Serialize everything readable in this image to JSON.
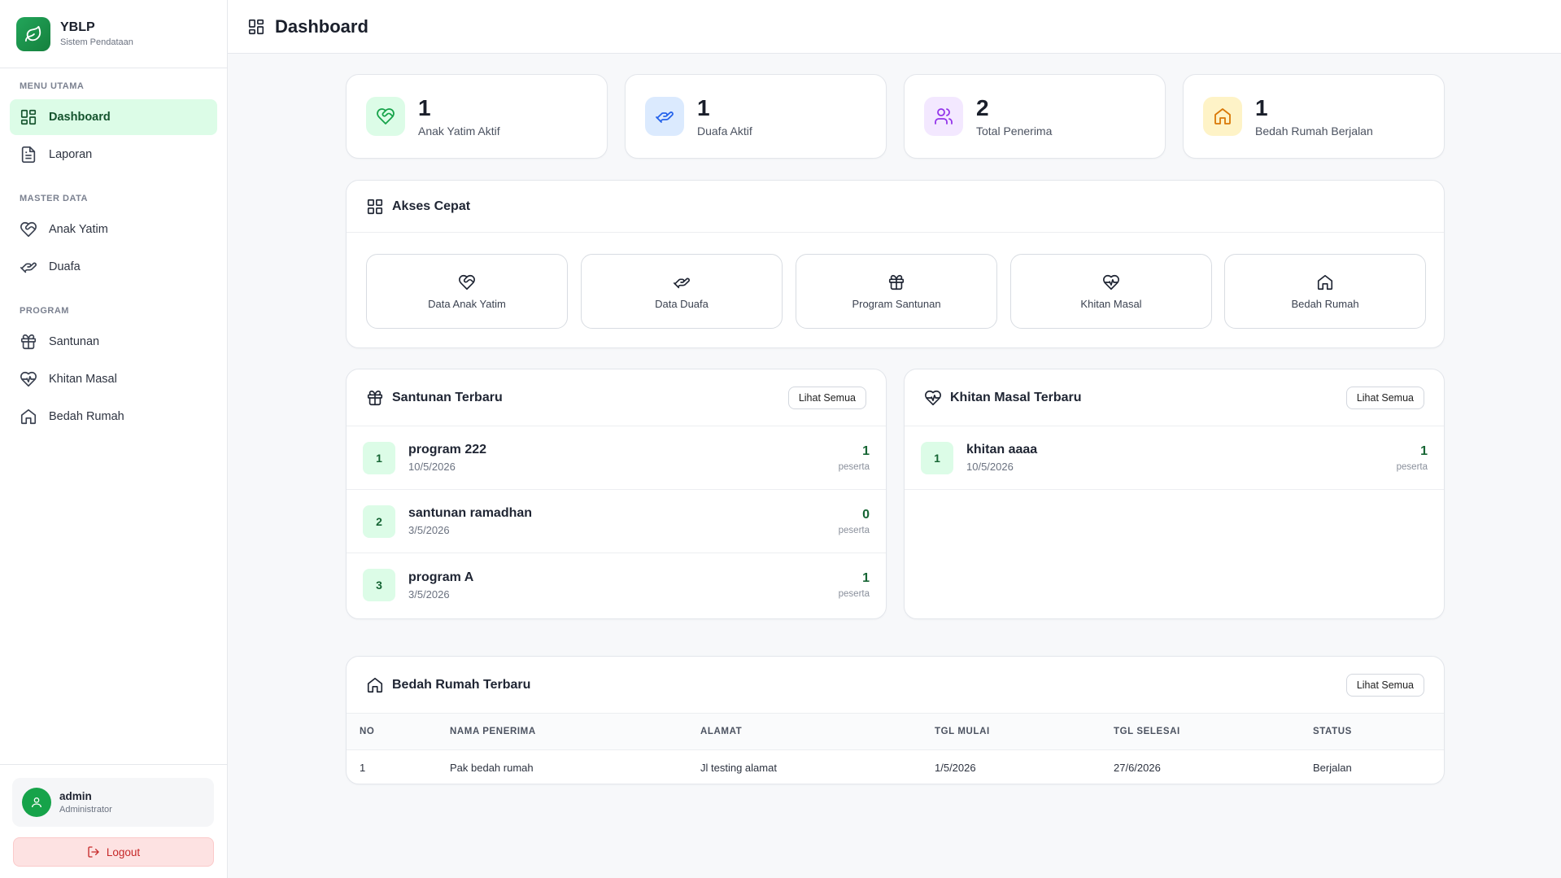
{
  "brand": {
    "title": "YBLP",
    "subtitle": "Sistem Pendataan"
  },
  "sidebar": {
    "sections": [
      {
        "heading": "MENU UTAMA",
        "items": [
          {
            "label": "Dashboard",
            "icon": "grid-icon",
            "active": true
          },
          {
            "label": "Laporan",
            "icon": "document-icon"
          }
        ]
      },
      {
        "heading": "MASTER DATA",
        "items": [
          {
            "label": "Anak Yatim",
            "icon": "heart-hand-icon"
          },
          {
            "label": "Duafa",
            "icon": "hand-coins-icon"
          }
        ]
      },
      {
        "heading": "PROGRAM",
        "items": [
          {
            "label": "Santunan",
            "icon": "gift-icon"
          },
          {
            "label": "Khitan Masal",
            "icon": "heart-pulse-icon"
          },
          {
            "label": "Bedah Rumah",
            "icon": "home-icon"
          }
        ]
      }
    ],
    "user": {
      "name": "admin",
      "role": "Administrator"
    },
    "logout_label": "Logout"
  },
  "header": {
    "title": "Dashboard"
  },
  "stats": [
    {
      "value": "1",
      "label": "Anak Yatim Aktif",
      "color": "#16a34a",
      "bg": "#dcfce7"
    },
    {
      "value": "1",
      "label": "Duafa Aktif",
      "color": "#2563eb",
      "bg": "#dbeafe"
    },
    {
      "value": "2",
      "label": "Total Penerima",
      "color": "#9333ea",
      "bg": "#f3e8ff"
    },
    {
      "value": "1",
      "label": "Bedah Rumah Berjalan",
      "color": "#d97706",
      "bg": "#fef3c7"
    }
  ],
  "quick_access": {
    "title": "Akses Cepat",
    "items": [
      {
        "label": "Data Anak Yatim",
        "icon": "heart-hand-icon"
      },
      {
        "label": "Data Duafa",
        "icon": "hand-coins-icon"
      },
      {
        "label": "Program Santunan",
        "icon": "gift-icon"
      },
      {
        "label": "Khitan Masal",
        "icon": "heart-pulse-icon"
      },
      {
        "label": "Bedah Rumah",
        "icon": "home-icon"
      }
    ]
  },
  "santunan": {
    "title": "Santunan Terbaru",
    "view_all": "Lihat Semua",
    "items": [
      {
        "no": "1",
        "name": "program 222",
        "date": "10/5/2026",
        "count": "1",
        "unit": "peserta"
      },
      {
        "no": "2",
        "name": "santunan ramadhan",
        "date": "3/5/2026",
        "count": "0",
        "unit": "peserta"
      },
      {
        "no": "3",
        "name": "program A",
        "date": "3/5/2026",
        "count": "1",
        "unit": "peserta"
      }
    ]
  },
  "khitan": {
    "title": "Khitan Masal Terbaru",
    "view_all": "Lihat Semua",
    "items": [
      {
        "no": "1",
        "name": "khitan aaaa",
        "date": "10/5/2026",
        "count": "1",
        "unit": "peserta"
      }
    ]
  },
  "bedah": {
    "title": "Bedah Rumah Terbaru",
    "view_all": "Lihat Semua",
    "columns": [
      "NO",
      "NAMA PENERIMA",
      "ALAMAT",
      "TGL MULAI",
      "TGL SELESAI",
      "STATUS"
    ],
    "rows": [
      [
        "1",
        "Pak bedah rumah",
        "Jl testing alamat",
        "1/5/2026",
        "27/6/2026",
        "Berjalan"
      ]
    ]
  }
}
